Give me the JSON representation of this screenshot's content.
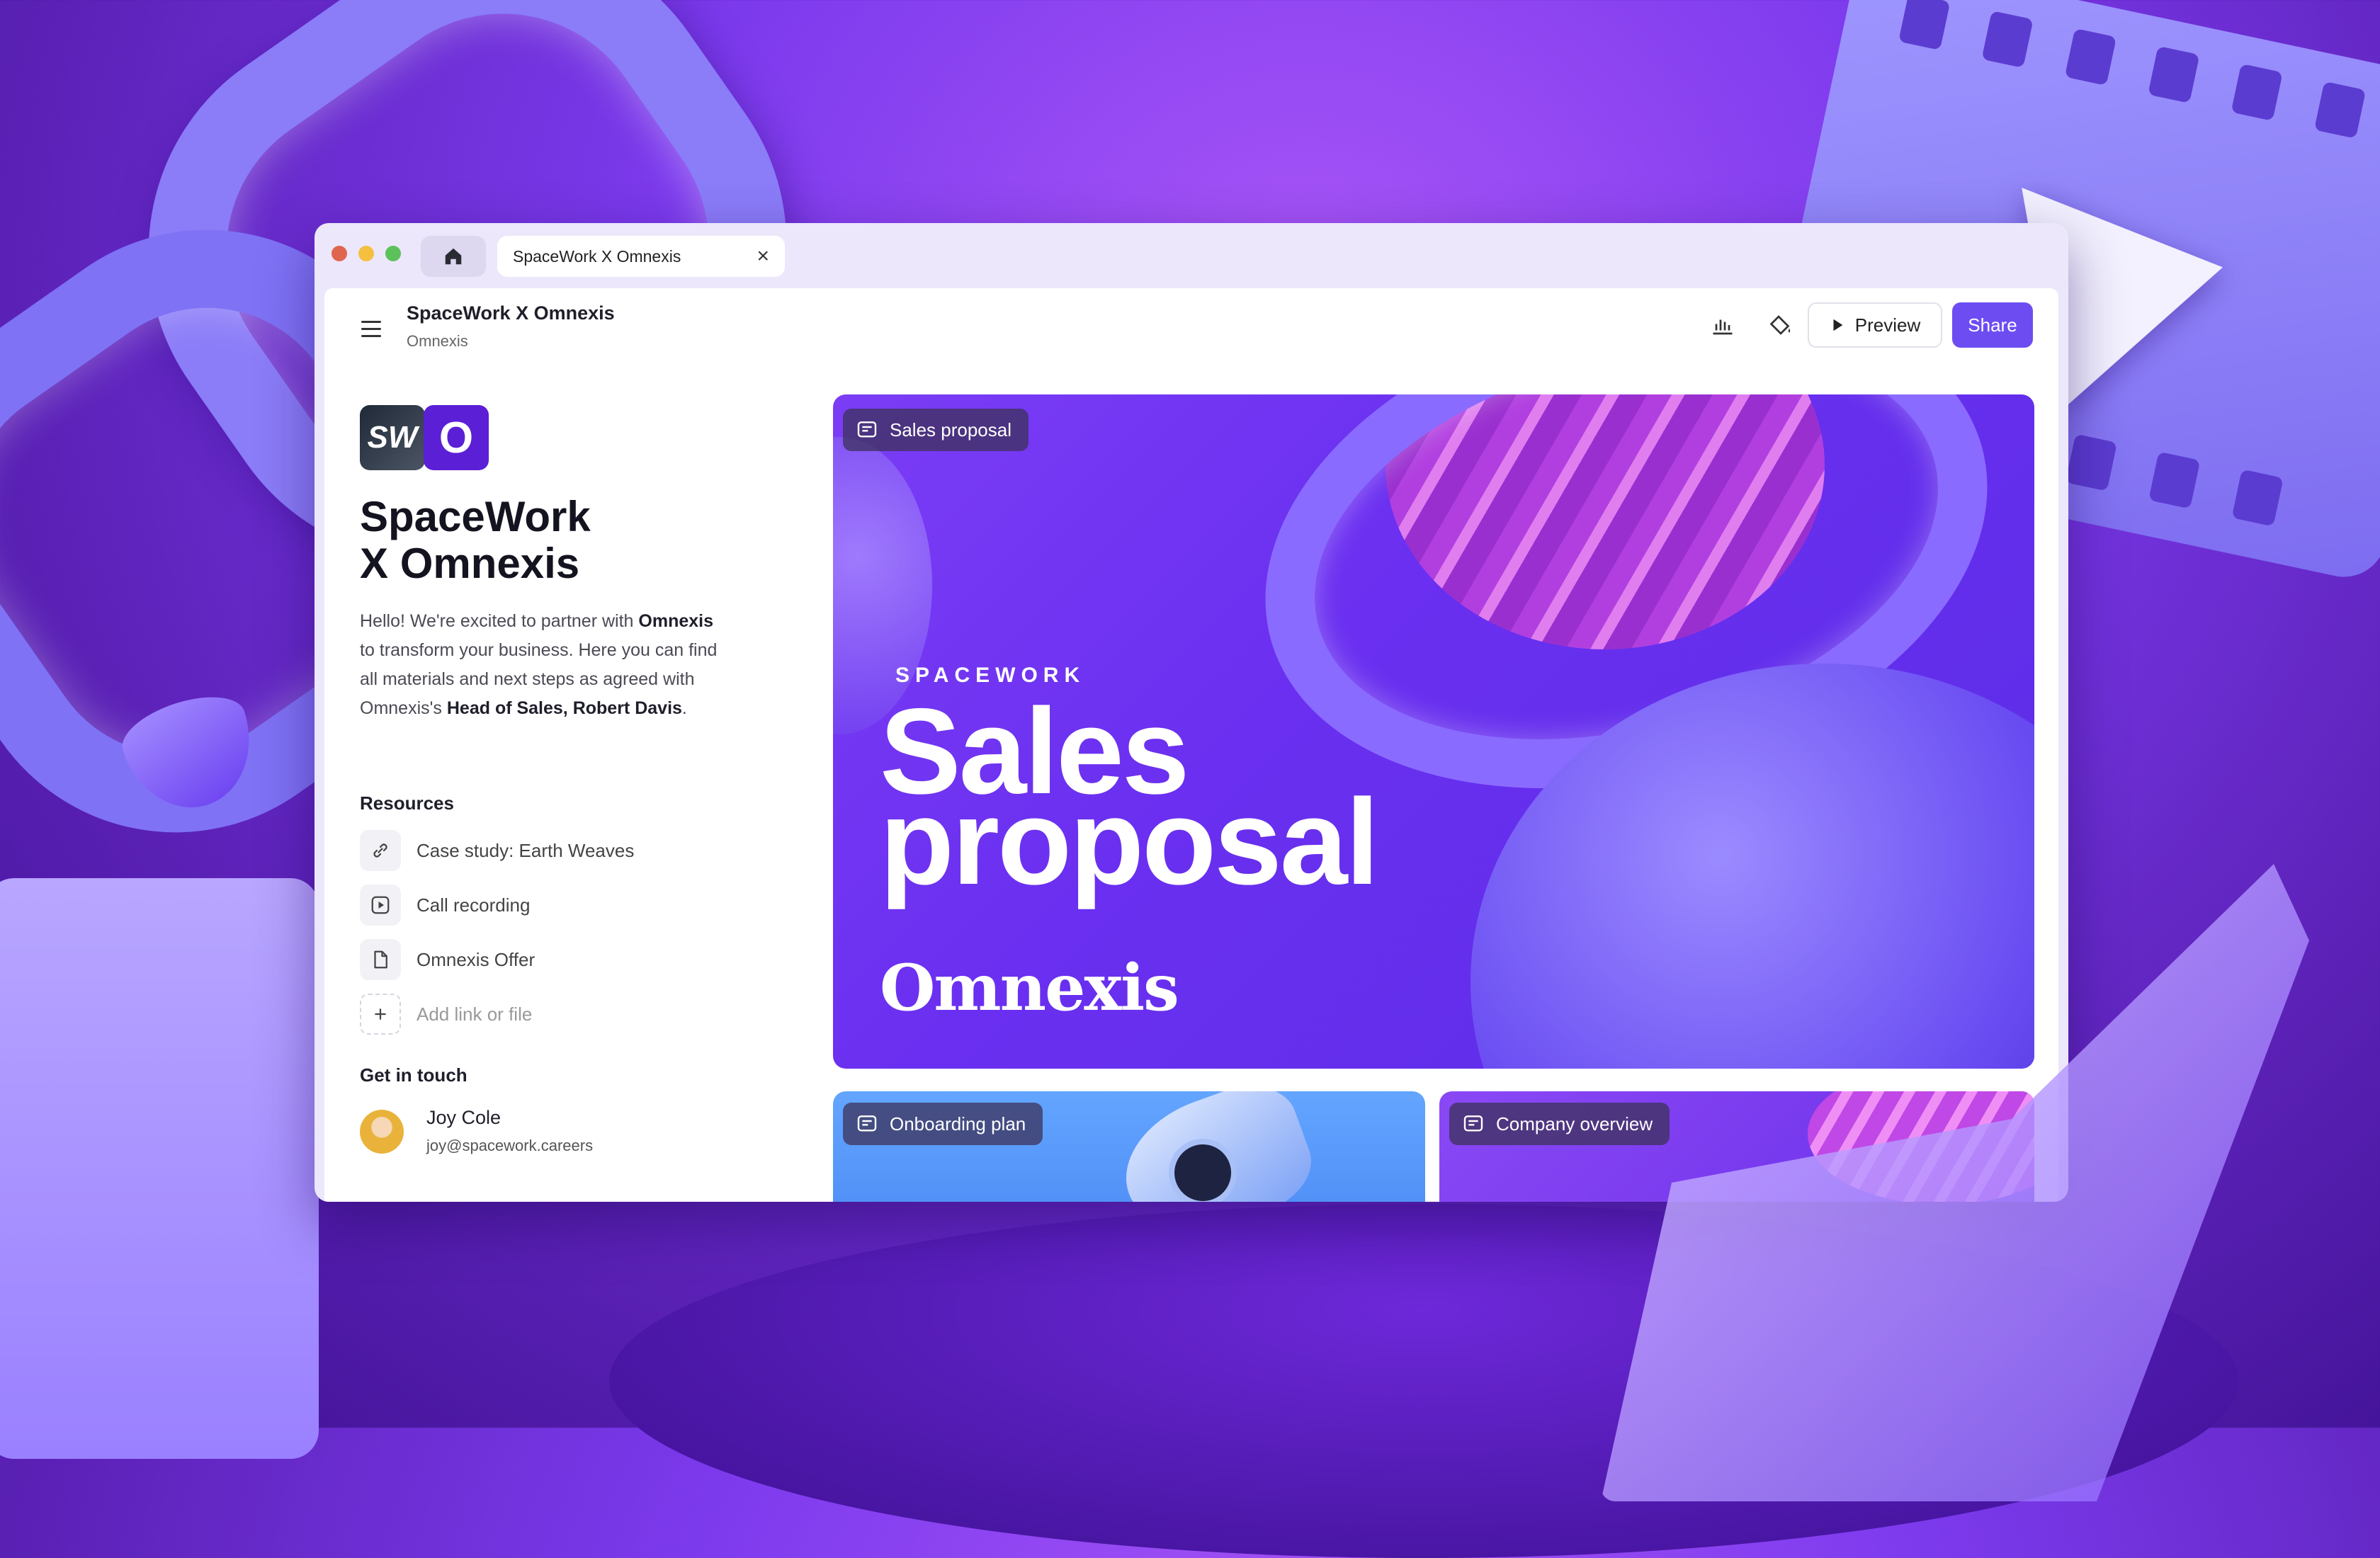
{
  "colors": {
    "accent": "#6d4df2",
    "hero_bg": "#6a2ff0",
    "onboarding_bg": "#5b9bff",
    "traffic_red": "#e0654f",
    "traffic_yellow": "#f5bf3f",
    "traffic_green": "#5cc15b"
  },
  "browser": {
    "tab_title": "SpaceWork X Omnexis",
    "home_icon": "home-icon",
    "close_icon": "close-icon"
  },
  "header": {
    "title": "SpaceWork X Omnexis",
    "subtitle": "Omnexis",
    "analytics_icon": "bar-chart-icon",
    "theme_icon": "paint-bucket-icon",
    "preview_label": "Preview",
    "share_label": "Share"
  },
  "sidebar": {
    "logo_left": "SW",
    "logo_right": "O",
    "title_line1": "SpaceWork",
    "title_line2": "X Omnexis",
    "intro": {
      "p1": "Hello! We're excited to partner with",
      "b1": "Omnexis",
      "p2": " to transform your business. Here you can find all materials and next steps as agreed with Omnexis's ",
      "b2": "Head of Sales, Robert Davis",
      "p3": "."
    },
    "resources_heading": "Resources",
    "resources": [
      {
        "label": "Case study: Earth Weaves",
        "icon": "link-icon"
      },
      {
        "label": "Call recording",
        "icon": "play-icon"
      },
      {
        "label": "Omnexis Offer",
        "icon": "file-icon"
      }
    ],
    "add_label": "Add link or file",
    "contact_heading": "Get in touch",
    "contact": {
      "name": "Joy Cole",
      "email": "joy@spacework.careers"
    }
  },
  "cards": {
    "hero": {
      "chip": "Sales proposal",
      "brand": "SPACEWORK",
      "headline_line1": "Sales",
      "headline_line2": "proposal",
      "client": "Omnexis"
    },
    "onboarding": {
      "chip": "Onboarding plan"
    },
    "company": {
      "chip": "Company overview"
    }
  }
}
